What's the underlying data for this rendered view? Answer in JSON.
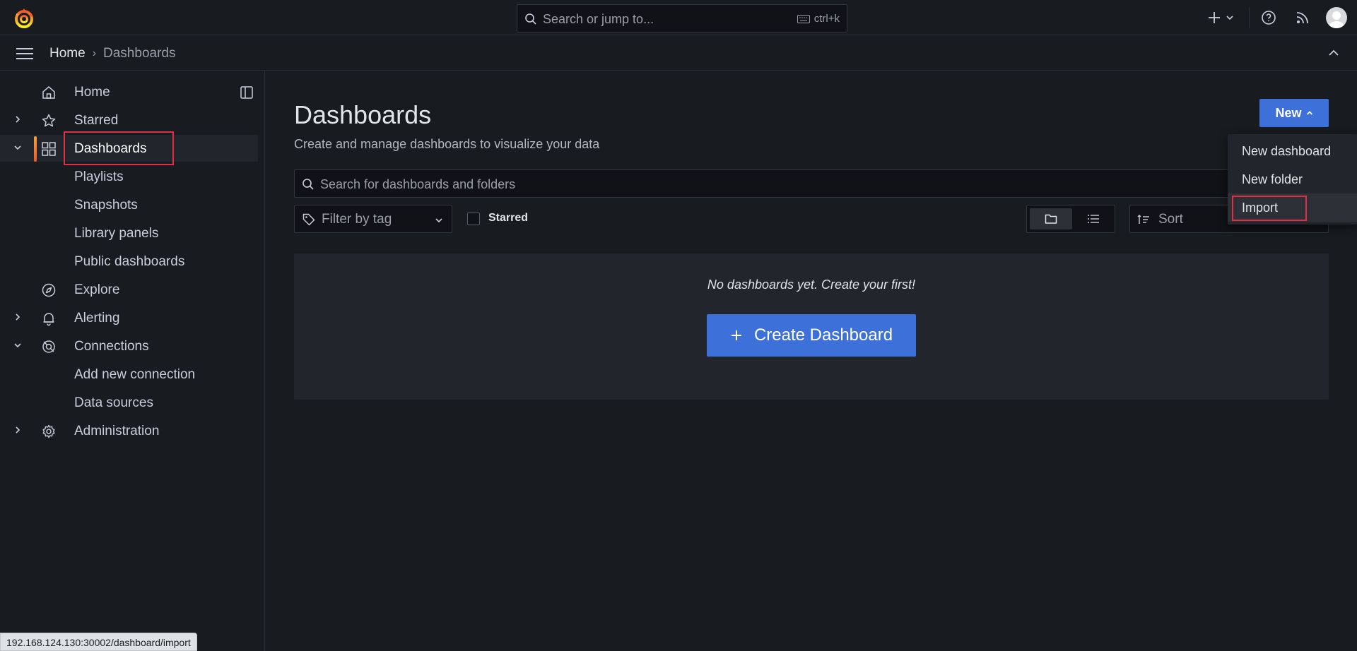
{
  "topbar": {
    "search_placeholder": "Search or jump to...",
    "shortcut": "ctrl+k"
  },
  "breadcrumb": {
    "home": "Home",
    "separator": "›",
    "current": "Dashboards"
  },
  "sidebar": {
    "items": [
      {
        "label": "Home"
      },
      {
        "label": "Starred"
      },
      {
        "label": "Dashboards"
      },
      {
        "label": "Playlists"
      },
      {
        "label": "Snapshots"
      },
      {
        "label": "Library panels"
      },
      {
        "label": "Public dashboards"
      },
      {
        "label": "Explore"
      },
      {
        "label": "Alerting"
      },
      {
        "label": "Connections"
      },
      {
        "label": "Add new connection"
      },
      {
        "label": "Data sources"
      },
      {
        "label": "Administration"
      }
    ]
  },
  "main": {
    "title": "Dashboards",
    "subtitle": "Create and manage dashboards to visualize your data",
    "new_button": "New",
    "search_placeholder": "Search for dashboards and folders",
    "tag_filter_placeholder": "Filter by tag",
    "starred_label": "Starred",
    "sort_placeholder": "Sort",
    "empty_text": "No dashboards yet. Create your first!",
    "create_button": "Create Dashboard"
  },
  "new_menu": {
    "items": [
      "New dashboard",
      "New folder",
      "Import"
    ]
  },
  "status_url": "192.168.124.130:30002/dashboard/import",
  "colors": {
    "accent": "#3d71d9",
    "highlight": "#e02f44",
    "background": "#181b1f"
  }
}
